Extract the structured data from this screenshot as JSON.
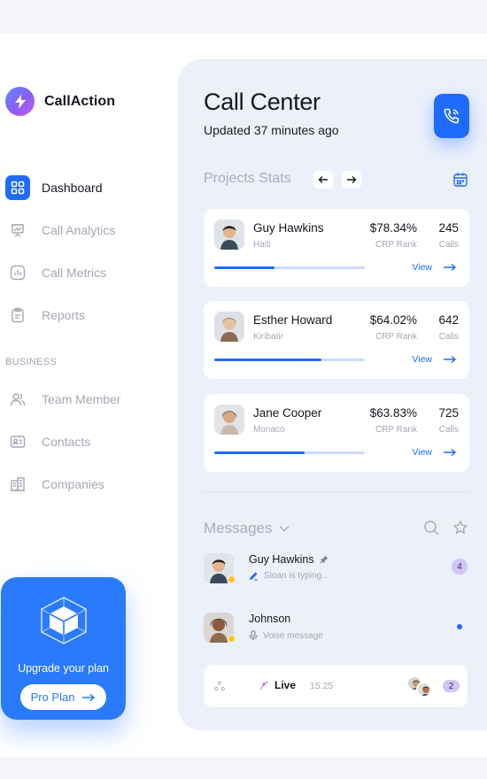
{
  "brand": {
    "name": "CallAction"
  },
  "sidebar": {
    "items": [
      {
        "label": "Dashboard",
        "icon": "grid-icon",
        "active": true
      },
      {
        "label": "Call Analytics",
        "icon": "presentation-chart-icon"
      },
      {
        "label": "Call Metrics",
        "icon": "bar-chart-icon"
      },
      {
        "label": "Reports",
        "icon": "clipboard-icon"
      }
    ],
    "section_label": "BUSINESS",
    "business_items": [
      {
        "label": "Team Member",
        "icon": "users-icon"
      },
      {
        "label": "Contacts",
        "icon": "contact-card-icon"
      },
      {
        "label": "Companies",
        "icon": "buildings-icon"
      }
    ],
    "upgrade": {
      "text": "Upgrade your plan",
      "button": "Pro Plan"
    }
  },
  "header": {
    "title": "Call Center",
    "subtitle": "Updated 37 minutes ago",
    "call_button_icon": "phone-icon"
  },
  "stats": {
    "title": "Projects Stats",
    "cards": [
      {
        "name": "Guy Hawkins",
        "location": "Haiti",
        "rate": "$78.34%",
        "rate_label": "CRP Rank",
        "calls": "245",
        "calls_label": "Calls",
        "progress": 0.4,
        "view": "View"
      },
      {
        "name": "Esther Howard",
        "location": "Kiribatir",
        "rate": "$64.02%",
        "rate_label": "CRP Rank",
        "calls": "642",
        "calls_label": "Calls",
        "progress": 0.71,
        "view": "View"
      },
      {
        "name": "Jane Cooper",
        "location": "Monaco",
        "rate": "$63.83%",
        "rate_label": "CRP Rank",
        "calls": "725",
        "calls_label": "Calls",
        "progress": 0.6,
        "view": "View"
      }
    ]
  },
  "messages": {
    "title": "Messages",
    "items": [
      {
        "name": "Guy Hawkins",
        "status": "Sloan is typing...",
        "count": "4",
        "pinned": true
      },
      {
        "name": "Johnson",
        "status": "Voise message"
      }
    ]
  },
  "live": {
    "label": "Live",
    "time": "15:25",
    "count": "2"
  },
  "colors": {
    "accent": "#1f6bff",
    "badge": "#d3c5f8",
    "muted": "#a5a9b6"
  }
}
